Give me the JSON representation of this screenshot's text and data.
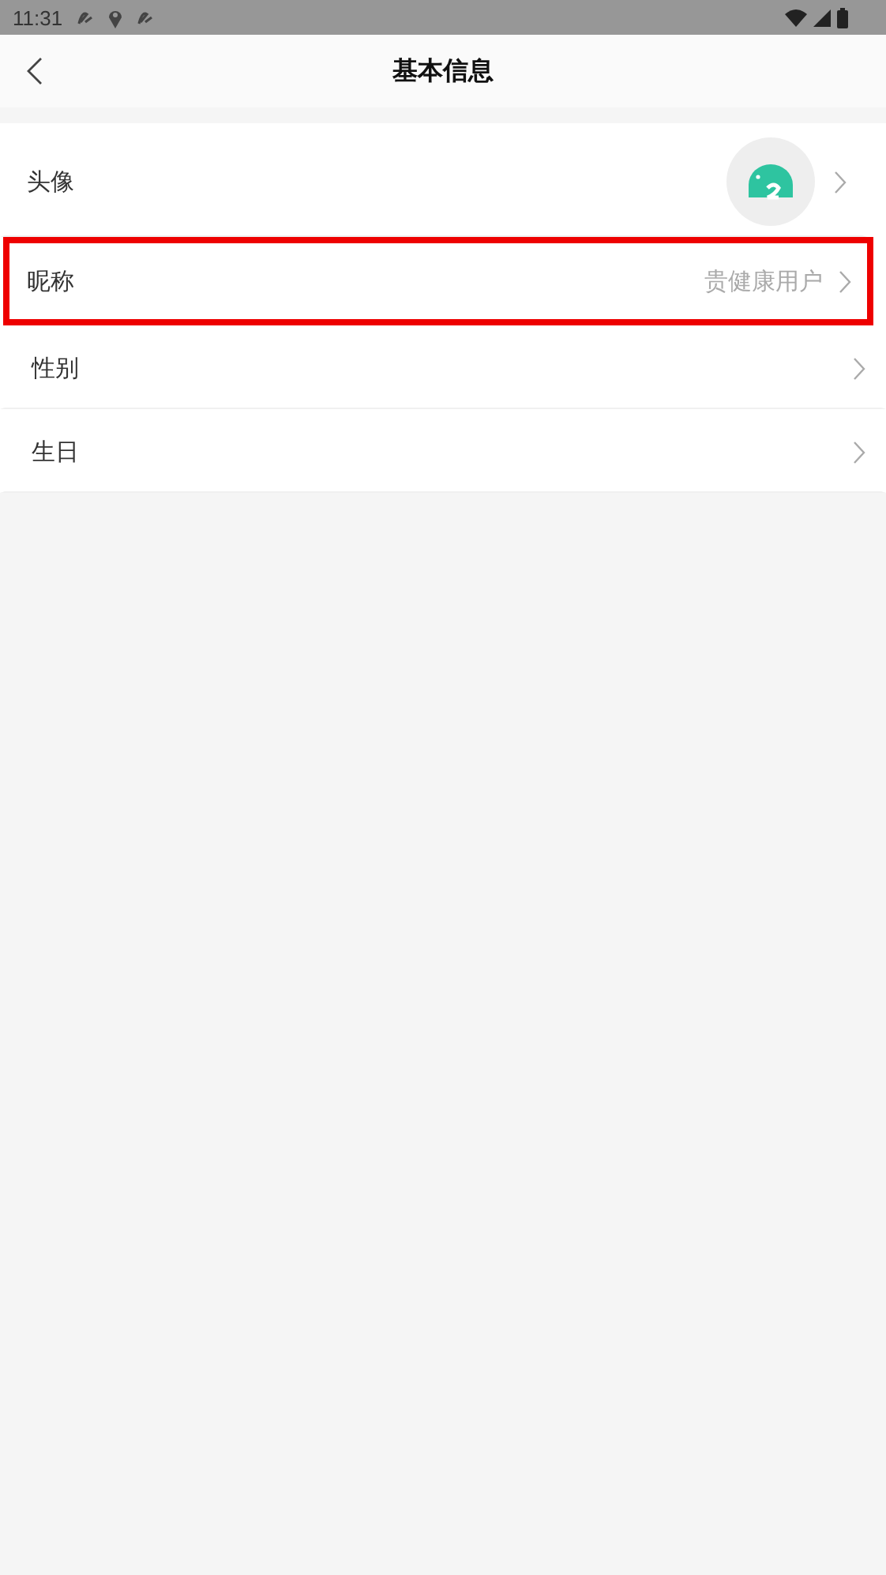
{
  "status_bar": {
    "time": "11:31"
  },
  "header": {
    "title": "基本信息"
  },
  "rows": [
    {
      "kind": "avatar",
      "label": "头像",
      "highlighted": false
    },
    {
      "kind": "text",
      "label": "昵称",
      "value": "贵健康用户",
      "highlighted": true
    },
    {
      "kind": "text",
      "label": "性别",
      "highlighted": false
    },
    {
      "kind": "text",
      "label": "生日",
      "highlighted": false
    }
  ]
}
